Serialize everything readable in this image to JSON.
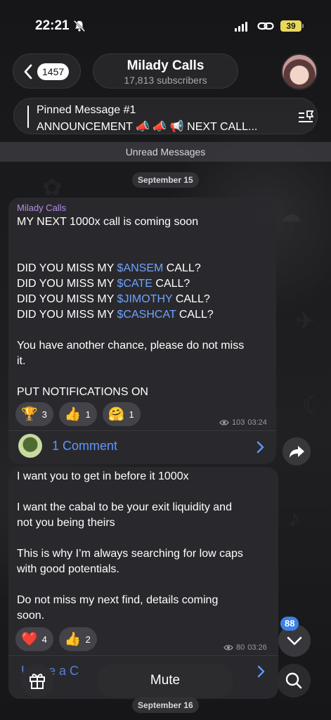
{
  "status_bar": {
    "time": "22:21",
    "battery": "39"
  },
  "header": {
    "back_count": "1457",
    "channel_name": "Milady Calls",
    "subscribers": "17,813 subscribers"
  },
  "pinned": {
    "title": "Pinned Message #1",
    "preview": "ANNOUNCEMENT 📣 📣 📢 NEXT CALL..."
  },
  "unread_label": "Unread Messages",
  "dates": [
    "September 15",
    "September 16"
  ],
  "message1": {
    "sender": "Milady Calls",
    "line1": "MY NEXT 1000x call is coming soon",
    "calls": [
      {
        "pre": "DID YOU MISS MY ",
        "tag": "$ANSEM",
        "post": " CALL?"
      },
      {
        "pre": "DID YOU MISS MY ",
        "tag": "$CATE",
        "post": " CALL?"
      },
      {
        "pre": "DID YOU MISS MY ",
        "tag": "$JIMOTHY",
        "post": " CALL?"
      },
      {
        "pre": "DID YOU MISS MY ",
        "tag": "$CASHCAT",
        "post": " CALL?"
      }
    ],
    "chance_line1": "You have another chance, please do not miss",
    "chance_line2": "it.",
    "notify": "PUT NOTIFICATIONS ON",
    "reactions": [
      {
        "emoji": "🏆",
        "count": "3"
      },
      {
        "emoji": "👍",
        "count": "1"
      },
      {
        "emoji": "🤗",
        "count": "1"
      }
    ],
    "views": "103",
    "time": "03:24",
    "comments_label": "1 Comment"
  },
  "message2": {
    "lines": [
      "I want you to get in before it 1000x",
      "I want the cabal to be your exit liquidity and",
      "not you being theirs",
      "This is why I’m always searching for low caps",
      "with good potentials.",
      "Do not miss my next find, details coming",
      "soon."
    ],
    "reactions": [
      {
        "emoji": "❤️",
        "count": "4"
      },
      {
        "emoji": "👍",
        "count": "2"
      }
    ],
    "views": "80",
    "time": "03:26",
    "leave_comment": "Leave a C"
  },
  "scroll_badge": "88",
  "bottom": {
    "mute_label": "Mute"
  },
  "colors": {
    "accent": "#5e97ff",
    "sender": "#b38ee8",
    "badge": "#3b82e8",
    "battery": "#e9d95b"
  }
}
